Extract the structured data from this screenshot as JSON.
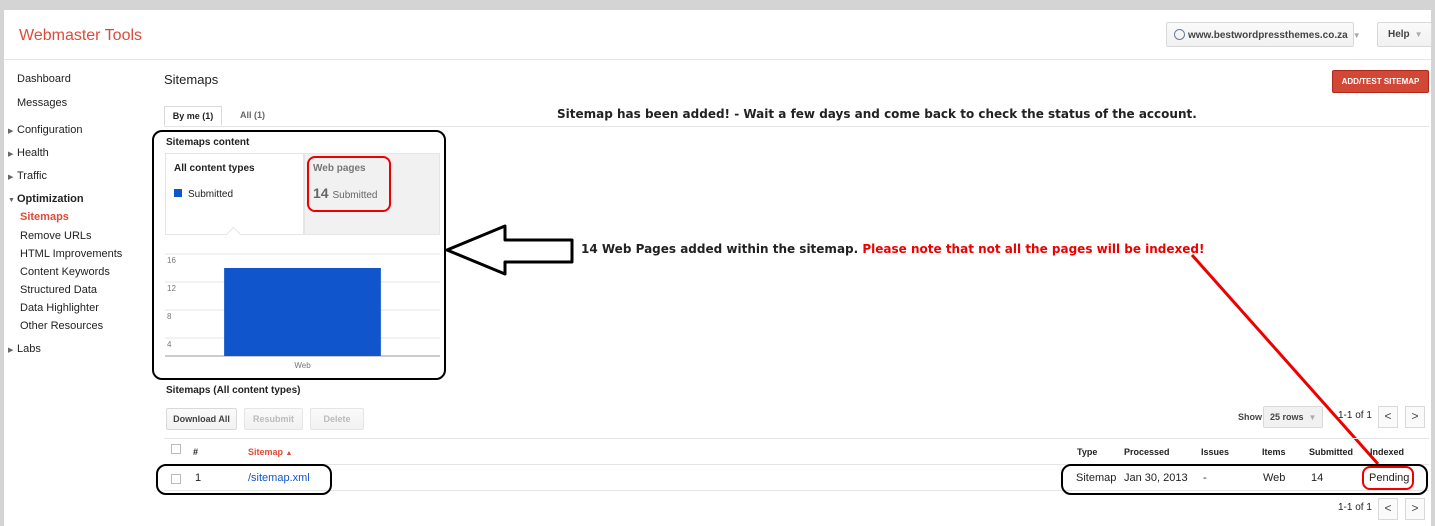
{
  "app": {
    "title": "Webmaster Tools"
  },
  "header": {
    "site": "www.bestwordpressthemes.co.za",
    "help": "Help"
  },
  "sidebar": {
    "items": [
      {
        "label": "Dashboard"
      },
      {
        "label": "Messages"
      },
      {
        "label": "Configuration"
      },
      {
        "label": "Health"
      },
      {
        "label": "Traffic"
      },
      {
        "label": "Optimization"
      },
      {
        "label": "Sitemaps"
      },
      {
        "label": "Remove URLs"
      },
      {
        "label": "HTML Improvements"
      },
      {
        "label": "Content Keywords"
      },
      {
        "label": "Structured Data"
      },
      {
        "label": "Data Highlighter"
      },
      {
        "label": "Other Resources"
      },
      {
        "label": "Labs"
      }
    ]
  },
  "page": {
    "title": "Sitemaps",
    "add_button": "ADD/TEST SITEMAP"
  },
  "tabs": [
    {
      "label": "By me (1)"
    },
    {
      "label": "All (1)"
    }
  ],
  "annotations": {
    "top": "Sitemap has been added! - Wait a few days and come back to check the status of the account.",
    "middle_black": "14 Web Pages added within the sitemap.",
    "middle_red": "Please note that not all the pages will be indexed!"
  },
  "content": {
    "section_title": "Sitemaps content",
    "all_types": {
      "label": "All content types",
      "legend": "Submitted"
    },
    "web_pages": {
      "label": "Web pages",
      "count": "14",
      "count_label": "Submitted"
    }
  },
  "chart_data": {
    "type": "bar",
    "categories": [
      "Web"
    ],
    "series": [
      {
        "name": "Submitted",
        "values": [
          14
        ]
      }
    ],
    "ylim": [
      0,
      16
    ],
    "yticks": [
      "16",
      "12",
      "8",
      "4"
    ],
    "color": "#1155cc",
    "grid": true
  },
  "table_section": {
    "title": "Sitemaps (All content types)",
    "buttons": {
      "download": "Download All",
      "resubmit": "Resubmit",
      "delete": "Delete"
    },
    "show_label": "Show",
    "rows_select": "25 rows",
    "pager": "1-1 of 1",
    "pager_bottom": "1-1 of 1",
    "columns": {
      "num": "#",
      "sitemap": "Sitemap",
      "sort_arrow": "▲",
      "type": "Type",
      "processed": "Processed",
      "issues": "Issues",
      "items": "Items",
      "submitted": "Submitted",
      "indexed": "Indexed"
    },
    "rows": [
      {
        "num": "1",
        "sitemap": "/sitemap.xml",
        "type": "Sitemap",
        "processed": "Jan 30, 2013",
        "issues": "-",
        "items": "Web",
        "submitted": "14",
        "indexed": "Pending"
      }
    ]
  },
  "colors": {
    "brand": "#dd4b39",
    "bar": "#1155cc",
    "annotation_red": "#e00000"
  }
}
